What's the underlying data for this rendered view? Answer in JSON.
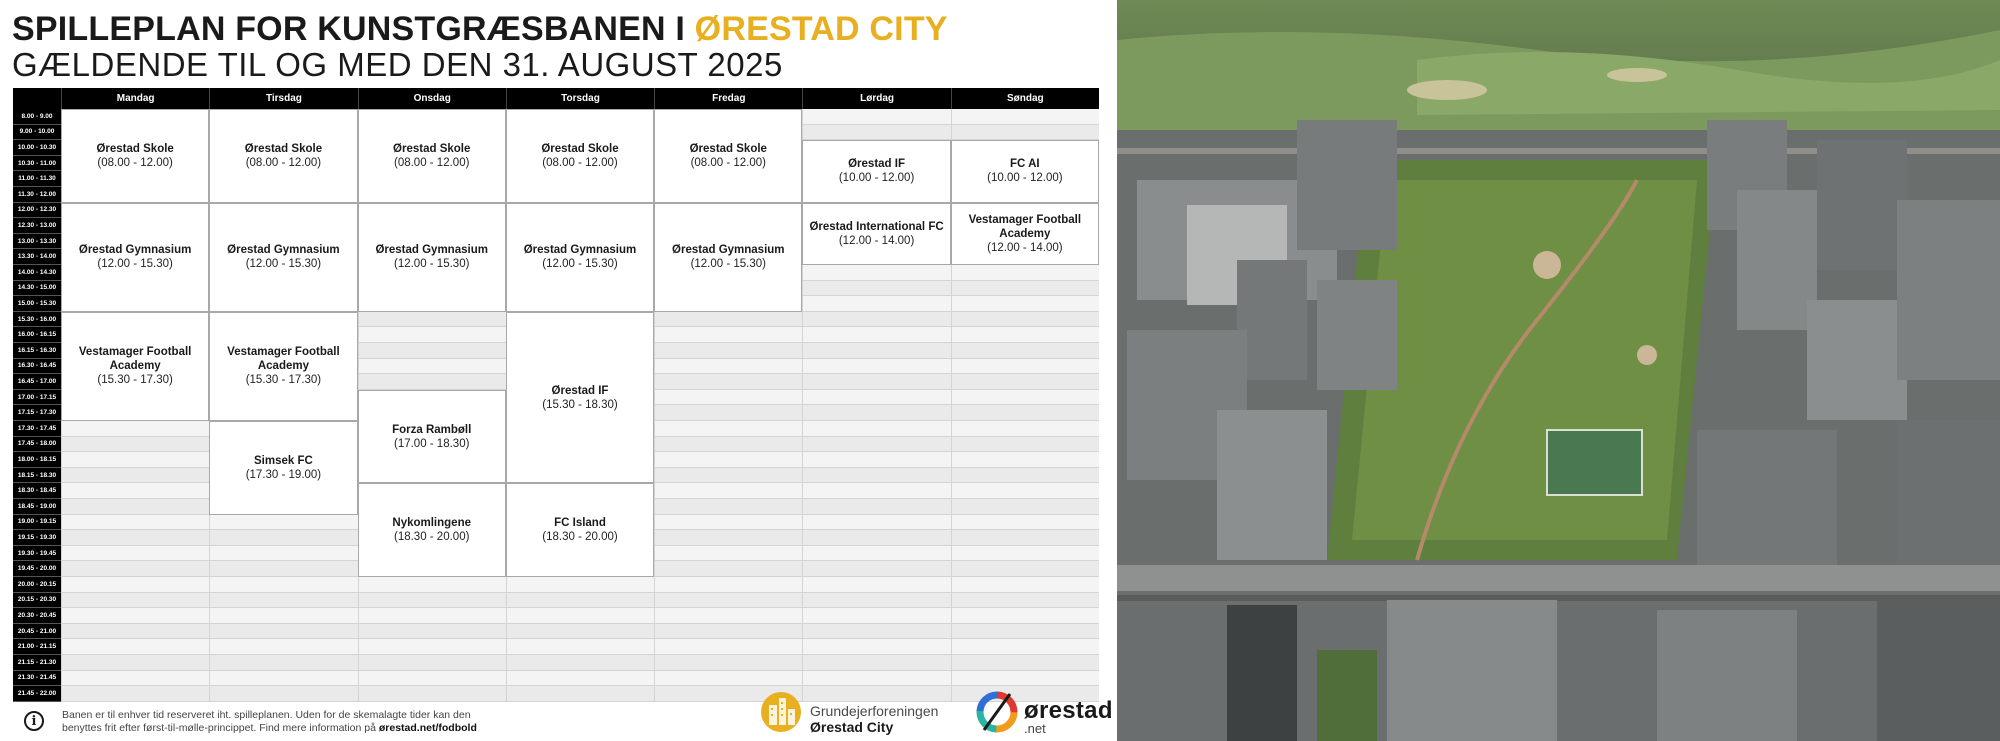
{
  "header": {
    "title_main": "SPILLEPLAN FOR KUNSTGRÆSBANEN I",
    "title_highlight": "ØRESTAD CITY",
    "subtitle": "GÆLDENDE TIL OG MED DEN 31. AUGUST 2025"
  },
  "colors": {
    "highlight": "#e8b020",
    "header_bg": "#000000",
    "booking_bg": "#ffffff",
    "free_slot": "#eeeeee"
  },
  "days": [
    "Mandag",
    "Tirsdag",
    "Onsdag",
    "Torsdag",
    "Fredag",
    "Lørdag",
    "Søndag"
  ],
  "time_slots": [
    "8.00 - 9.00",
    "9.00 - 10.00",
    "10.00 - 10.30",
    "10.30 - 11.00",
    "11.00 - 11.30",
    "11.30 - 12.00",
    "12.00 - 12.30",
    "12.30 - 13.00",
    "13.00 - 13.30",
    "13.30 - 14.00",
    "14.00 - 14.30",
    "14.30 - 15.00",
    "15.00 - 15.30",
    "15.30 - 16.00",
    "16.00 - 16.15",
    "16.15 - 16.30",
    "16.30 - 16.45",
    "16.45 - 17.00",
    "17.00 - 17.15",
    "17.15 - 17.30",
    "17.30 - 17.45",
    "17.45 - 18.00",
    "18.00 - 18.15",
    "18.15 - 18.30",
    "18.30 - 18.45",
    "18.45 - 19.00",
    "19.00 - 19.15",
    "19.15 - 19.30",
    "19.30 - 19.45",
    "19.45 - 20.00",
    "20.00 - 20.15",
    "20.15 - 20.30",
    "20.30 - 20.45",
    "20.45 - 21.00",
    "21.00 - 21.15",
    "21.15 - 21.30",
    "21.30 - 21.45",
    "21.45 - 22.00"
  ],
  "bookings": [
    {
      "day": 0,
      "from": 0,
      "to": 6,
      "name": "Ørestad Skole",
      "time": "(08.00 - 12.00)"
    },
    {
      "day": 0,
      "from": 6,
      "to": 13,
      "name": "Ørestad Gymnasium",
      "time": "(12.00 - 15.30)"
    },
    {
      "day": 0,
      "from": 13,
      "to": 20,
      "name": "Vestamager Football Academy",
      "time": "(15.30 - 17.30)"
    },
    {
      "day": 1,
      "from": 0,
      "to": 6,
      "name": "Ørestad Skole",
      "time": "(08.00 - 12.00)"
    },
    {
      "day": 1,
      "from": 6,
      "to": 13,
      "name": "Ørestad Gymnasium",
      "time": "(12.00 - 15.30)"
    },
    {
      "day": 1,
      "from": 13,
      "to": 20,
      "name": "Vestamager Football Academy",
      "time": "(15.30 - 17.30)"
    },
    {
      "day": 1,
      "from": 20,
      "to": 26,
      "name": "Simsek FC",
      "time": "(17.30 - 19.00)"
    },
    {
      "day": 2,
      "from": 0,
      "to": 6,
      "name": "Ørestad Skole",
      "time": "(08.00 - 12.00)"
    },
    {
      "day": 2,
      "from": 6,
      "to": 13,
      "name": "Ørestad Gymnasium",
      "time": "(12.00 - 15.30)"
    },
    {
      "day": 2,
      "from": 18,
      "to": 24,
      "name": "Forza Rambøll",
      "time": "(17.00 - 18.30)"
    },
    {
      "day": 2,
      "from": 24,
      "to": 30,
      "name": "Nykomlingene",
      "time": "(18.30 - 20.00)"
    },
    {
      "day": 3,
      "from": 0,
      "to": 6,
      "name": "Ørestad Skole",
      "time": "(08.00 - 12.00)"
    },
    {
      "day": 3,
      "from": 6,
      "to": 13,
      "name": "Ørestad Gymnasium",
      "time": "(12.00 - 15.30)"
    },
    {
      "day": 3,
      "from": 13,
      "to": 24,
      "name": "Ørestad IF",
      "time": "(15.30 - 18.30)"
    },
    {
      "day": 3,
      "from": 24,
      "to": 30,
      "name": "FC Island",
      "time": "(18.30 - 20.00)"
    },
    {
      "day": 4,
      "from": 0,
      "to": 6,
      "name": "Ørestad Skole",
      "time": "(08.00 - 12.00)"
    },
    {
      "day": 4,
      "from": 6,
      "to": 13,
      "name": "Ørestad Gymnasium",
      "time": "(12.00 - 15.30)"
    },
    {
      "day": 5,
      "from": 2,
      "to": 6,
      "name": "Ørestad IF",
      "time": "(10.00 - 12.00)"
    },
    {
      "day": 5,
      "from": 6,
      "to": 10,
      "name": "Ørestad International FC",
      "time": "(12.00 - 14.00)"
    },
    {
      "day": 6,
      "from": 2,
      "to": 6,
      "name": "FC AI",
      "time": "(10.00 - 12.00)"
    },
    {
      "day": 6,
      "from": 6,
      "to": 10,
      "name": "Vestamager Football Academy",
      "time": "(12.00 - 14.00)"
    }
  ],
  "footer": {
    "note_line1": "Banen er til enhver tid reserveret iht. spilleplanen. Uden for de skemalagte tider kan den",
    "note_line2": "benyttes frit efter først-til-mølle-princippet. Find mere information på",
    "note_link": "ørestad.net/fodbold",
    "info_icon": "i",
    "gf_line1": "Grundejerforeningen",
    "gf_line2": "Ørestad City",
    "ore_name": "ørestad",
    "ore_net": ".net"
  }
}
